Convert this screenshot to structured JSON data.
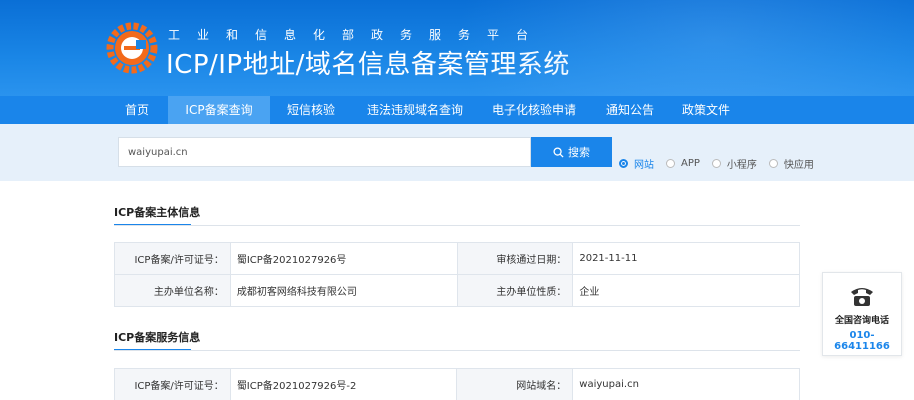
{
  "header": {
    "platform_name": "工业和信息化部政务服务平台",
    "system_name": "ICP/IP地址/域名信息备案管理系统"
  },
  "nav": {
    "items": [
      {
        "label": "首页",
        "active": false
      },
      {
        "label": "ICP备案查询",
        "active": true
      },
      {
        "label": "短信核验",
        "active": false
      },
      {
        "label": "违法违规域名查询",
        "active": false
      },
      {
        "label": "电子化核验申请",
        "active": false
      },
      {
        "label": "通知公告",
        "active": false
      },
      {
        "label": "政策文件",
        "active": false
      }
    ]
  },
  "search": {
    "value": "waiyupai.cn",
    "button_label": "搜索",
    "options": [
      {
        "label": "网站",
        "checked": true
      },
      {
        "label": "APP",
        "checked": false
      },
      {
        "label": "小程序",
        "checked": false
      },
      {
        "label": "快应用",
        "checked": false
      }
    ]
  },
  "subject_info": {
    "title": "ICP备案主体信息",
    "rows": [
      {
        "label1": "ICP备案/许可证号：",
        "value1": "蜀ICP备2021027926号",
        "label2": "审核通过日期：",
        "value2": "2021-11-11"
      },
      {
        "label1": "主办单位名称：",
        "value1": "成都初客网络科技有限公司",
        "label2": "主办单位性质：",
        "value2": "企业"
      }
    ]
  },
  "service_info": {
    "title": "ICP备案服务信息",
    "rows": [
      {
        "label1": "ICP备案/许可证号：",
        "value1": "蜀ICP备2021027926号-2",
        "label2": "网站域名：",
        "value2": "waiyupai.cn"
      }
    ]
  },
  "contact": {
    "label": "全国咨询电话",
    "number": "010-66411166"
  },
  "colors": {
    "primary": "#1a85ea",
    "nav_active": "#4aa3f2",
    "logo_orange": "#f26a1b"
  }
}
